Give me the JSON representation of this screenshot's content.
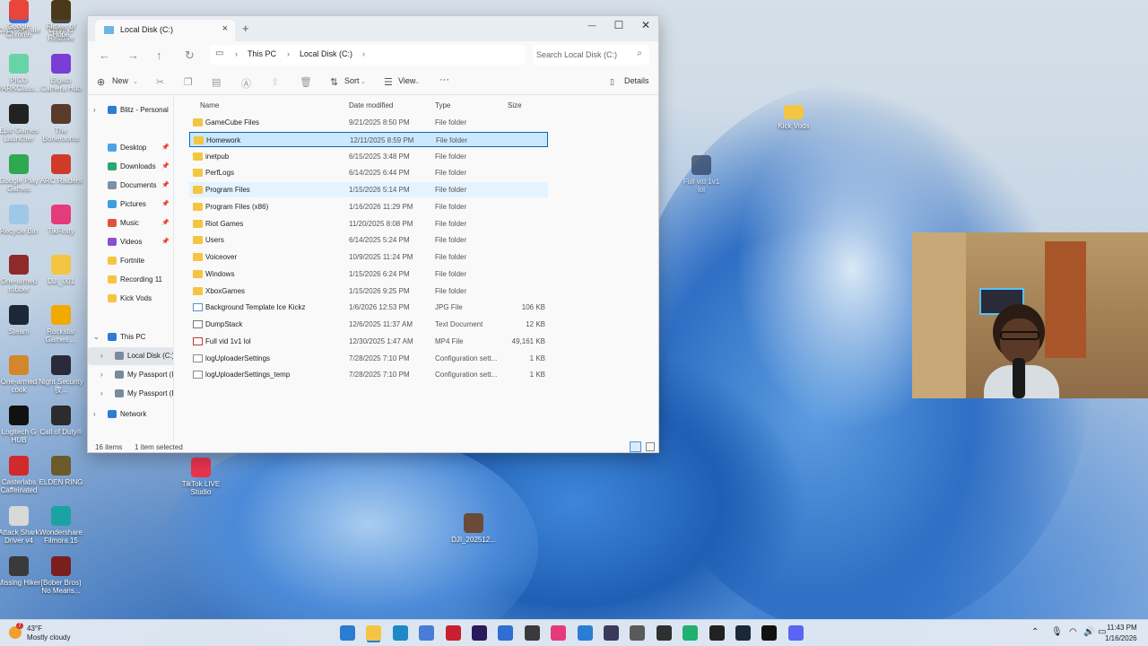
{
  "desktop": {
    "icons_left": [
      {
        "label": "Clash Royale",
        "color": "#3b6fd6"
      },
      {
        "label": "DaVinci Resolve",
        "color": "#4a4a4a"
      },
      {
        "label": "PICO PARKClass...",
        "color": "#67d4a6"
      },
      {
        "label": "Elgato Camera Hub",
        "color": "#7a3dd6"
      },
      {
        "label": "Epic Games Launcher",
        "color": "#222222"
      },
      {
        "label": "The Bonerooms",
        "color": "#5a3a2a"
      },
      {
        "label": "Google Play Games",
        "color": "#2fa84f"
      },
      {
        "label": "ARC Raiders",
        "color": "#d13a2a"
      },
      {
        "label": "Recycle Bin",
        "color": "#9fc7e8"
      },
      {
        "label": "TikFinity",
        "color": "#e63b7a"
      },
      {
        "label": "One-armed robber",
        "color": "#8e2a2a"
      },
      {
        "label": "DJI_001",
        "color": "#f4c542"
      },
      {
        "label": "Steam",
        "color": "#1b2838"
      },
      {
        "label": "Rockstar Games ...",
        "color": "#f2a900"
      },
      {
        "label": "One-armed cook",
        "color": "#d4862a"
      },
      {
        "label": "Night Security 夜...",
        "color": "#2a2a3a"
      },
      {
        "label": "Logitech G HUB",
        "color": "#111111"
      },
      {
        "label": "Call of Duty®",
        "color": "#2c2c2c"
      },
      {
        "label": "Casterlabs Caffeinated",
        "color": "#d12a2a"
      },
      {
        "label": "ELDEN RING",
        "color": "#6b5a2a"
      },
      {
        "label": "Attack Shark Driver v4",
        "color": "#d8d8d8"
      },
      {
        "label": "Wondershare Filmora 15",
        "color": "#1ba3a3"
      },
      {
        "label": "Missing Hiker",
        "color": "#3a3a3a"
      },
      {
        "label": "[Bober Bros] No Means...",
        "color": "#7a1e1e"
      },
      {
        "label": "Google Chrome",
        "color": "#e8453c"
      },
      {
        "label": "Flicker of Hope",
        "color": "#4a3a1a"
      }
    ],
    "extra_icons": [
      {
        "label": "TikTok LIVE Studio",
        "color": "#e8344e"
      },
      {
        "label": "DJI_202512...",
        "color": "#6b4a3a"
      },
      {
        "label": "Kick Vods",
        "color": "#f4c542"
      },
      {
        "label": "Full vid 1v1 lol",
        "color": "#2a3a5a"
      }
    ]
  },
  "window": {
    "tab_title": "Local Disk (C:)",
    "close_tab": "×",
    "new_tab": "+",
    "minimize": "—",
    "maximize": "☐",
    "close": "✕",
    "breadcrumb": [
      "This PC",
      "Local Disk (C:)"
    ],
    "search_placeholder": "Search Local Disk (C:)",
    "toolbar": {
      "new": "New",
      "sort": "Sort",
      "view": "View",
      "more": "···",
      "details": "Details"
    },
    "sidebar": [
      {
        "label": "Blitz - Personal",
        "icon": "cloud-icon",
        "color": "#2b7cd3",
        "chevron": true,
        "pinned": false
      },
      {
        "label": "Desktop",
        "icon": "desktop-icon",
        "color": "#4aa3e8",
        "chevron": false,
        "pinned": true
      },
      {
        "label": "Downloads",
        "icon": "download-icon",
        "color": "#2aa872",
        "chevron": false,
        "pinned": true
      },
      {
        "label": "Documents",
        "icon": "document-icon",
        "color": "#7b8fa8",
        "chevron": false,
        "pinned": true
      },
      {
        "label": "Pictures",
        "icon": "pictures-icon",
        "color": "#3b9fe0",
        "chevron": false,
        "pinned": true
      },
      {
        "label": "Music",
        "icon": "music-icon",
        "color": "#e0533b",
        "chevron": false,
        "pinned": true
      },
      {
        "label": "Videos",
        "icon": "videos-icon",
        "color": "#8a4fd6",
        "chevron": false,
        "pinned": true
      },
      {
        "label": "Fortnite",
        "icon": "folder-icon",
        "color": "#f4c542",
        "chevron": false,
        "pinned": false
      },
      {
        "label": "Recording 11",
        "icon": "folder-icon",
        "color": "#f4c542",
        "chevron": false,
        "pinned": false
      },
      {
        "label": "Kick Vods",
        "icon": "folder-icon",
        "color": "#f4c542",
        "chevron": false,
        "pinned": false
      },
      {
        "label": "This PC",
        "icon": "pc-icon",
        "color": "#2b7cd3",
        "chevron": true,
        "pinned": false
      },
      {
        "label": "Local Disk (C:)",
        "icon": "drive-icon",
        "color": "#7a8a9a",
        "chevron": true,
        "pinned": false
      },
      {
        "label": "My Passport (I",
        "icon": "drive-icon",
        "color": "#7a8a9a",
        "chevron": true,
        "pinned": false
      },
      {
        "label": "My Passport (E:",
        "icon": "drive-icon",
        "color": "#7a8a9a",
        "chevron": true,
        "pinned": false
      },
      {
        "label": "Network",
        "icon": "network-icon",
        "color": "#2b7cd3",
        "chevron": true,
        "pinned": false
      }
    ],
    "columns": {
      "name": "Name",
      "date": "Date modified",
      "type": "Type",
      "size": "Size"
    },
    "files": [
      {
        "name": "GameCube Files",
        "date": "9/21/2025 8:50 PM",
        "type": "File folder",
        "size": "",
        "kind": "folder"
      },
      {
        "name": "Homework",
        "date": "12/11/2025 8:59 PM",
        "type": "File folder",
        "size": "",
        "kind": "folder"
      },
      {
        "name": "inetpub",
        "date": "6/15/2025 3:48 PM",
        "type": "File folder",
        "size": "",
        "kind": "folder"
      },
      {
        "name": "PerfLogs",
        "date": "6/14/2025 6:44 PM",
        "type": "File folder",
        "size": "",
        "kind": "folder"
      },
      {
        "name": "Program Files",
        "date": "1/15/2026 5:14 PM",
        "type": "File folder",
        "size": "",
        "kind": "folder"
      },
      {
        "name": "Program Files (x86)",
        "date": "1/16/2026 11:29 PM",
        "type": "File folder",
        "size": "",
        "kind": "folder"
      },
      {
        "name": "Riot Games",
        "date": "11/20/2025 8:08 PM",
        "type": "File folder",
        "size": "",
        "kind": "folder"
      },
      {
        "name": "Users",
        "date": "6/14/2025 5:24 PM",
        "type": "File folder",
        "size": "",
        "kind": "folder"
      },
      {
        "name": "Voiceover",
        "date": "10/9/2025 11:24 PM",
        "type": "File folder",
        "size": "",
        "kind": "folder"
      },
      {
        "name": "Windows",
        "date": "1/15/2026 6:24 PM",
        "type": "File folder",
        "size": "",
        "kind": "folder"
      },
      {
        "name": "XboxGames",
        "date": "1/15/2026 9:25 PM",
        "type": "File folder",
        "size": "",
        "kind": "folder"
      },
      {
        "name": "Background Template Ice Kickz",
        "date": "1/6/2026 12:53 PM",
        "type": "JPG File",
        "size": "106 KB",
        "kind": "img"
      },
      {
        "name": "DumpStack",
        "date": "12/6/2025 11:37 AM",
        "type": "Text Document",
        "size": "12 KB",
        "kind": "doc"
      },
      {
        "name": "Full vid 1v1 lol",
        "date": "12/30/2025 1:47 AM",
        "type": "MP4 File",
        "size": "49,161 KB",
        "kind": "vid"
      },
      {
        "name": "logUploaderSettings",
        "date": "7/28/2025 7:10 PM",
        "type": "Configuration sett...",
        "size": "1 KB",
        "kind": "cfg"
      },
      {
        "name": "logUploaderSettings_temp",
        "date": "7/28/2025 7:10 PM",
        "type": "Configuration sett...",
        "size": "1 KB",
        "kind": "cfg"
      }
    ],
    "selected_row": 1,
    "hover_row": 4,
    "status": {
      "items": "16 items",
      "selected": "1 item selected"
    }
  },
  "taskbar": {
    "weather_temp": "43°F",
    "weather_text": "Mostly cloudy",
    "weather_badge": "7",
    "time": "11:43 PM",
    "date": "1/16/2026",
    "apps": [
      {
        "name": "start-icon",
        "color": "#2b7cd3"
      },
      {
        "name": "file-explorer-icon",
        "color": "#f4c542"
      },
      {
        "name": "edge-icon",
        "color": "#1e88c8"
      },
      {
        "name": "store-icon",
        "color": "#4a7bd6"
      },
      {
        "name": "app-red-icon",
        "color": "#c8202e"
      },
      {
        "name": "premiere-icon",
        "color": "#2a1a5a"
      },
      {
        "name": "outlook-icon",
        "color": "#2f6fd1"
      },
      {
        "name": "davinci-icon",
        "color": "#3a3a3a"
      },
      {
        "name": "tikfinity-icon",
        "color": "#e63b7a"
      },
      {
        "name": "app-blue-icon",
        "color": "#2b7cd3"
      },
      {
        "name": "app-dark-icon",
        "color": "#3a3a5a"
      },
      {
        "name": "calculator-icon",
        "color": "#5a5a5a"
      },
      {
        "name": "obs-icon",
        "color": "#303030"
      },
      {
        "name": "app-green-icon",
        "color": "#20b070"
      },
      {
        "name": "epic-icon",
        "color": "#222222"
      },
      {
        "name": "steam-icon",
        "color": "#1b2838"
      },
      {
        "name": "capcut-icon",
        "color": "#111111"
      },
      {
        "name": "discord-icon",
        "color": "#5865f2"
      }
    ]
  }
}
